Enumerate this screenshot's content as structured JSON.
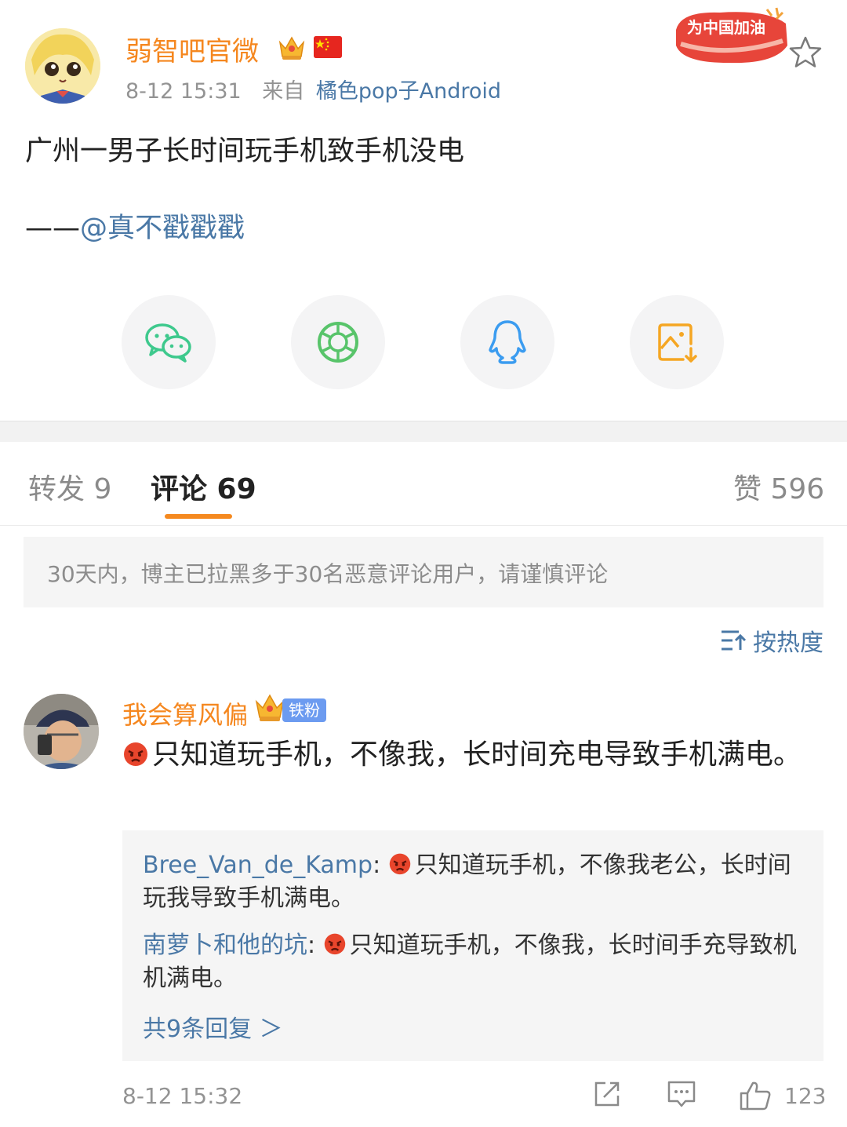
{
  "post": {
    "author": "弱智吧官微",
    "time": "8-12 15:31",
    "source_prefix": "来自",
    "source": "橘色pop子Android",
    "badge_text": "为中国加油",
    "text": "广州一男子长时间玩手机致手机没电",
    "credit_prefix": "——",
    "credit_mention": "@真不戳戳戳"
  },
  "share": [
    {
      "name": "wechat-icon",
      "color": "#3ec98d"
    },
    {
      "name": "moments-icon",
      "color": "#58c46a"
    },
    {
      "name": "qq-icon",
      "color": "#3b9cf0"
    },
    {
      "name": "save-image-icon",
      "color": "#f5a623"
    }
  ],
  "tabs": {
    "repost": "转发 9",
    "comments": "评论 69",
    "likes": "赞 596"
  },
  "notice": "30天内，博主已拉黑多于30名恶意评论用户，请谨慎评论",
  "sort_label": "按热度",
  "comment": {
    "author": "我会算风偏",
    "fan_badge": "铁粉",
    "text": "只知道玩手机，不像我，长时间充电导致手机满电。",
    "time": "8-12 15:32",
    "like_count": "123",
    "replies": [
      {
        "author": "Bree_Van_de_Kamp",
        "text": "只知道玩手机，不像我老公，长时间玩我导致手机满电。"
      },
      {
        "author": "南萝卜和他的坑",
        "text": "只知道玩手机，不像我，长时间手充导致机机满电。"
      }
    ],
    "more_replies": "共9条回复 ＞"
  },
  "colors": {
    "accent_orange": "#f5871f",
    "link_blue": "#4a78a6"
  }
}
